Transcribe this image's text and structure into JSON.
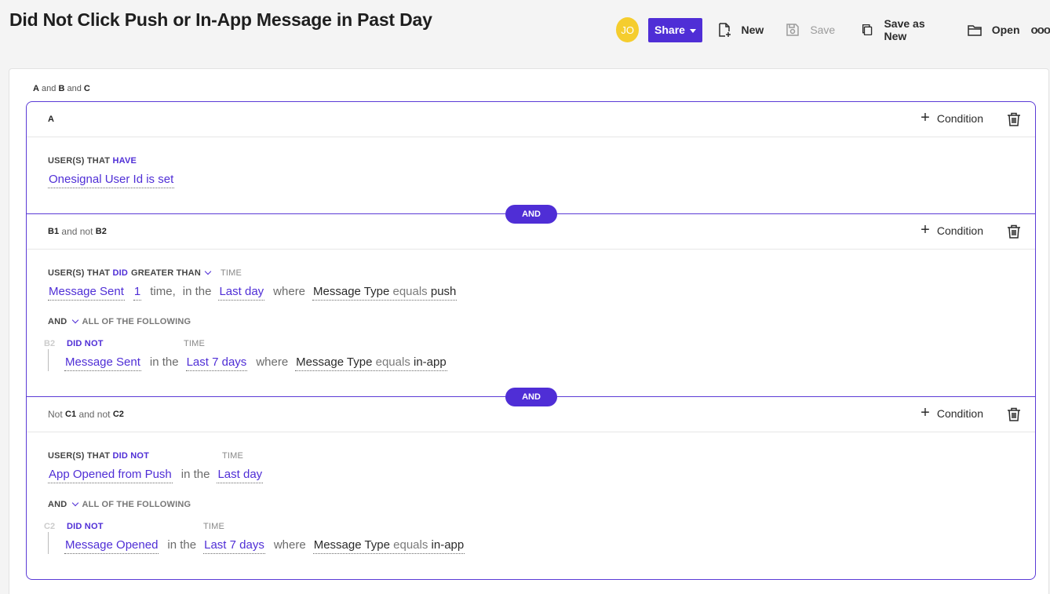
{
  "header": {
    "title": "Did Not Click Push or In-App Message in Past Day",
    "avatar_initials": "JO",
    "share_label": "Share",
    "new_label": "New",
    "save_label": "Save",
    "save_as_new_label": "Save as New",
    "open_label": "Open",
    "more_label": "ooo"
  },
  "colors": {
    "accent": "#4f2ed6",
    "avatar": "#f5cd2e"
  },
  "expression": {
    "a": "A",
    "and1": "and",
    "b": "B",
    "and2": "and",
    "c": "C"
  },
  "and_pill": "AND",
  "condition_label": "Condition",
  "sections": {
    "a": {
      "head": "A",
      "label_prefix": "USER(S) THAT",
      "label_verb": "HAVE",
      "value": "Onesignal User Id is set"
    },
    "b": {
      "head_b1": "B1",
      "head_mid": "and not",
      "head_b2": "B2",
      "label_prefix": "USER(S) THAT",
      "label_verb": "DID",
      "comparator": "GREATER THAN",
      "time_label": "TIME",
      "event": "Message Sent",
      "count": "1",
      "time_word": "time,",
      "in_the": "in the",
      "range": "Last day",
      "where": "where",
      "filter_prop": "Message Type",
      "filter_op": "equals",
      "filter_val": "push",
      "and_label": "AND",
      "all_following": "ALL OF THE FOLLOWING",
      "sub_tag": "B2",
      "sub_verb": "DID NOT",
      "sub_time_label": "TIME",
      "sub_event": "Message Sent",
      "sub_in_the": "in the",
      "sub_range": "Last 7 days",
      "sub_where": "where",
      "sub_filter_prop": "Message Type",
      "sub_filter_op": "equals",
      "sub_filter_val": "in-app"
    },
    "c": {
      "head_not": "Not",
      "head_c1": "C1",
      "head_mid": "and not",
      "head_c2": "C2",
      "label_prefix": "USER(S) THAT",
      "label_verb": "DID NOT",
      "time_label": "TIME",
      "event": "App Opened from Push",
      "in_the": "in the",
      "range": "Last day",
      "and_label": "AND",
      "all_following": "ALL OF THE FOLLOWING",
      "sub_tag": "C2",
      "sub_verb": "DID NOT",
      "sub_time_label": "TIME",
      "sub_event": "Message Opened",
      "sub_in_the": "in the",
      "sub_range": "Last 7 days",
      "sub_where": "where",
      "sub_filter_prop": "Message Type",
      "sub_filter_op": "equals",
      "sub_filter_val": "in-app"
    }
  }
}
